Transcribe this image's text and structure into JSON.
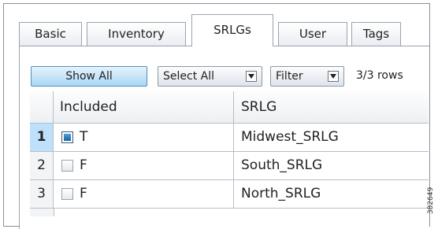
{
  "tabs": [
    {
      "label": "Basic"
    },
    {
      "label": "Inventory"
    },
    {
      "label": "SRLGs"
    },
    {
      "label": "User"
    },
    {
      "label": "Tags"
    }
  ],
  "toolbar": {
    "show_all_label": "Show All",
    "select_all_label": "Select All",
    "filter_label": "Filter",
    "rows_count": "3/3 rows"
  },
  "table": {
    "columns": [
      "Included",
      "SRLG"
    ],
    "rows": [
      {
        "num": "1",
        "included": "T",
        "checked": true,
        "srlg": "Midwest_SRLG"
      },
      {
        "num": "2",
        "included": "F",
        "checked": false,
        "srlg": "South_SRLG"
      },
      {
        "num": "3",
        "included": "F",
        "checked": false,
        "srlg": "North_SRLG"
      }
    ]
  },
  "figure_id": "382649",
  "colors": {
    "accent": "#a9d6f5",
    "selected_row": "#bfe0fa",
    "checkbox_fill": "#1f5f9c"
  }
}
